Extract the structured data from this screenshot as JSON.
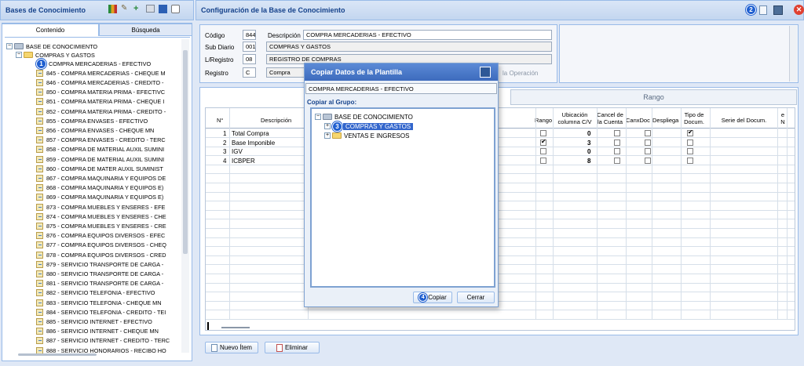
{
  "left_panel": {
    "title": "Bases de Conocimiento",
    "tabs": [
      "Contenido",
      "Búsqueda"
    ]
  },
  "tree": {
    "root": "BASE DE CONOCIMIENTO",
    "group": "COMPRAS Y GASTOS",
    "items": [
      "COMPRA MERCADERIAS - EFECTIVO",
      "845 - COMPRA MERCADERIAS - CHEQUE M",
      "846 - COMPRA MERCADERIAS - CREDITO -",
      "850 - COMPRA MATERIA PRIMA - EFECTIVC",
      "851 - COMPRA MATERIA PRIMA - CHEQUE I",
      "852 - COMPRA MATERIA PRIMA - CREDITO -",
      "855 - COMPRA ENVASES - EFECTIVO",
      "856 - COMPRA ENVASES - CHEQUE MN",
      "857 - COMPRA ENVASES - CREDITO - TERC",
      "858 - COMPRA DE MATERIAL AUXIL SUMINI",
      "859 - COMPRA DE MATERIAL AUXIL SUMINI",
      "860 - COMPRA DE MATER AUXIL SUMINIST",
      "867 - COMPRA MAQUINARIA Y EQUIPOS DE",
      "868 - COMPRA MAQUINARIA Y EQUIPOS E)",
      "869 - COMPRA MAQUINARIA Y EQUIPOS E)",
      "873 - COMPRA MUEBLES Y ENSERES - EFE",
      "874 - COMPRA MUEBLES Y ENSERES - CHE",
      "875 - COMPRA MUEBLES Y ENSERES - CRE",
      "876 - COMPRA EQUIPOS DIVERSOS - EFEC",
      "877 - COMPRA EQUIPOS DIVERSOS - CHEQ",
      "878 - COMPRA EQUIPOS DIVERSOS - CRED",
      "879 - SERVICIO TRANSPORTE DE CARGA -",
      "880 - SERVICIO TRANSPORTE DE CARGA -",
      "881 - SERVICIO TRANSPORTE DE CARGA -",
      "882 - SERVICIO TELEFONIA - EFECTIVO",
      "883 - SERVICIO TELEFONIA - CHEQUE MN",
      "884 - SERVICIO TELEFONIA - CREDITO - TEI",
      "885 - SERVICIO INTERNET - EFECTIVO",
      "886 - SERVICIO INTERNET - CHEQUE MN",
      "887 - SERVICIO INTERNET - CREDITO - TERC",
      "888 - SERVICIO HONORARIOS - RECIBO HO"
    ]
  },
  "main": {
    "title": "Configuración de la Base de Conocimiento"
  },
  "form": {
    "codigo_label": "Código",
    "codigo": "844",
    "descripcion_label": "Descripción",
    "descripcion": "COMPRA MERCADERIAS - EFECTIVO",
    "subdiario_label": "Sub Diario",
    "subdiario": "001",
    "subdiario_desc": "COMPRAS Y GASTOS",
    "lregistro_label": "L/Registro",
    "lregistro": "08",
    "lregistro_desc": "REGISTRO DE COMPRAS",
    "registro_label": "Registro",
    "registro": "C",
    "registro_desc": "Compra",
    "operacion": "la Operación"
  },
  "grid": {
    "rango_header": "Rango",
    "columns": {
      "n": "N°",
      "descripcion": "Descripción",
      "rango": "Rango",
      "ubicacion": "Ubicación columna C/V",
      "cancel": "Cancel de la Cuenta",
      "canxdoc": "CanxDoc",
      "despliega": "Despliega",
      "tipo": "Tipo de Docum.",
      "serie": "Serie del Docum.",
      "extra": "e N"
    },
    "rows": [
      {
        "n": "1",
        "desc": "Total Compra",
        "rango": false,
        "ubic": "0",
        "cancel": false,
        "canx": false,
        "desp": true
      },
      {
        "n": "2",
        "desc": "Base Imponible",
        "rango": true,
        "ubic": "3",
        "cancel": false,
        "canx": false,
        "desp": false
      },
      {
        "n": "3",
        "desc": "IGV",
        "rango": false,
        "ubic": "0",
        "cancel": false,
        "canx": false,
        "desp": false
      },
      {
        "n": "4",
        "desc": "ICBPER",
        "rango": false,
        "ubic": "8",
        "cancel": false,
        "canx": false,
        "desp": false
      }
    ]
  },
  "bottom": {
    "new_item": "Nuevo Ítem",
    "delete": "Eliminar"
  },
  "dialog": {
    "title": "Copiar Datos de la Plantilla",
    "template": "COMPRA MERCADERIAS - EFECTIVO",
    "copy_to": "Copiar al Grupo:",
    "root": "BASE DE CONOCIMIENTO",
    "group1": "COMPRAS Y GASTOS",
    "group2": "VENTAS E INGRESOS",
    "copy_btn": "Copiar",
    "cancel_btn": "Cerrar"
  },
  "badges": {
    "b1": "1",
    "b2": "2",
    "b3": "3",
    "b4": "4"
  },
  "colors": {
    "header_bg": "#c3d6ef",
    "header_text": "#15428b",
    "selection": "#3366cc",
    "badge": "#1f5fd0",
    "close_red": "#e04030"
  }
}
